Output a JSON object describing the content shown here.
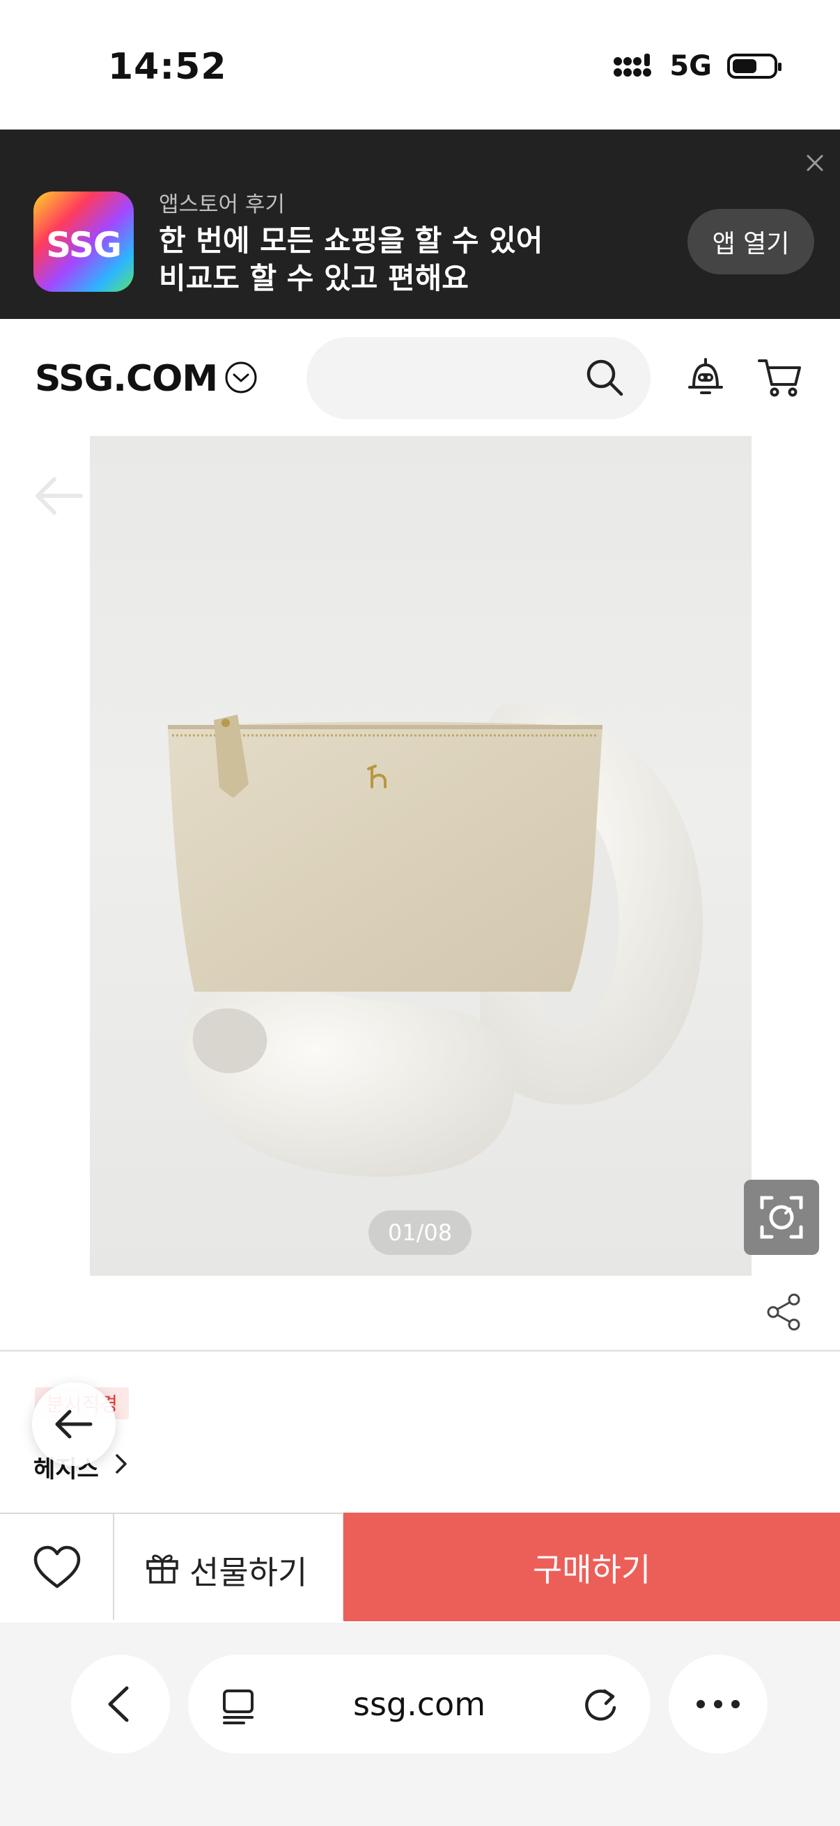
{
  "status_bar": {
    "time": "14:52",
    "network": "5G",
    "battery_level": 0.6
  },
  "app_banner": {
    "subtitle": "앱스토어 후기",
    "line1": "한 번에 모든 쇼핑을 할 수 있어",
    "line2": "비교도 할 수 있고 편해요",
    "logo_text": "SSG",
    "open_button": "앱 열기",
    "close_icon": "close-icon"
  },
  "header": {
    "brand": "SSG.COM",
    "search_placeholder": "",
    "icons": [
      "chevron-down-icon",
      "search-icon",
      "bell-icon",
      "cart-icon"
    ]
  },
  "product": {
    "page_indicator": "01/08",
    "tag": "분시직경",
    "brand_link": "헤지스",
    "colors": {
      "pouch": "#ddd3bd",
      "vase": "#f2f1ec"
    }
  },
  "action_bar": {
    "gift_label": "선물하기",
    "buy_label": "구매하기",
    "buy_color": "#ec5f59"
  },
  "browser": {
    "url": "ssg.com"
  }
}
